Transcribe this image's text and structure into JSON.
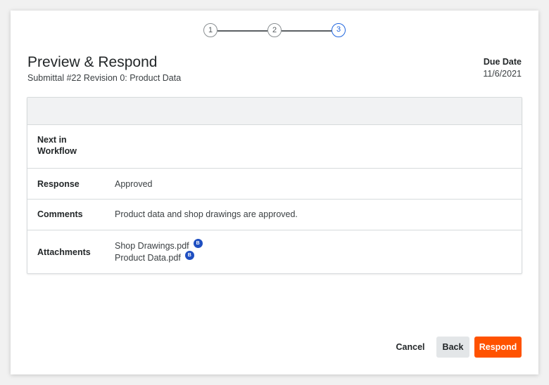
{
  "stepper": {
    "steps": [
      "1",
      "2",
      "3"
    ],
    "active_step": "3"
  },
  "header": {
    "title": "Preview & Respond",
    "subtitle": "Submittal #22 Revision 0: Product Data",
    "due_label": "Due Date",
    "due_value": "11/6/2021"
  },
  "details": {
    "next_in_workflow": {
      "label": "Next in Workflow",
      "value": ""
    },
    "response": {
      "label": "Response",
      "value": "Approved"
    },
    "comments": {
      "label": "Comments",
      "value": "Product data and shop drawings are approved."
    },
    "attachments": {
      "label": "Attachments",
      "files": [
        {
          "name": "Shop Drawings.pdf",
          "badge": "B"
        },
        {
          "name": "Product Data.pdf",
          "badge": "B"
        }
      ]
    }
  },
  "footer": {
    "cancel_label": "Cancel",
    "back_label": "Back",
    "respond_label": "Respond"
  },
  "colors": {
    "primary": "#ff5200",
    "active_step": "#2066df",
    "badge": "#1f4fc1"
  },
  "icons": {
    "attachment_badge": "bluebeam-icon"
  }
}
